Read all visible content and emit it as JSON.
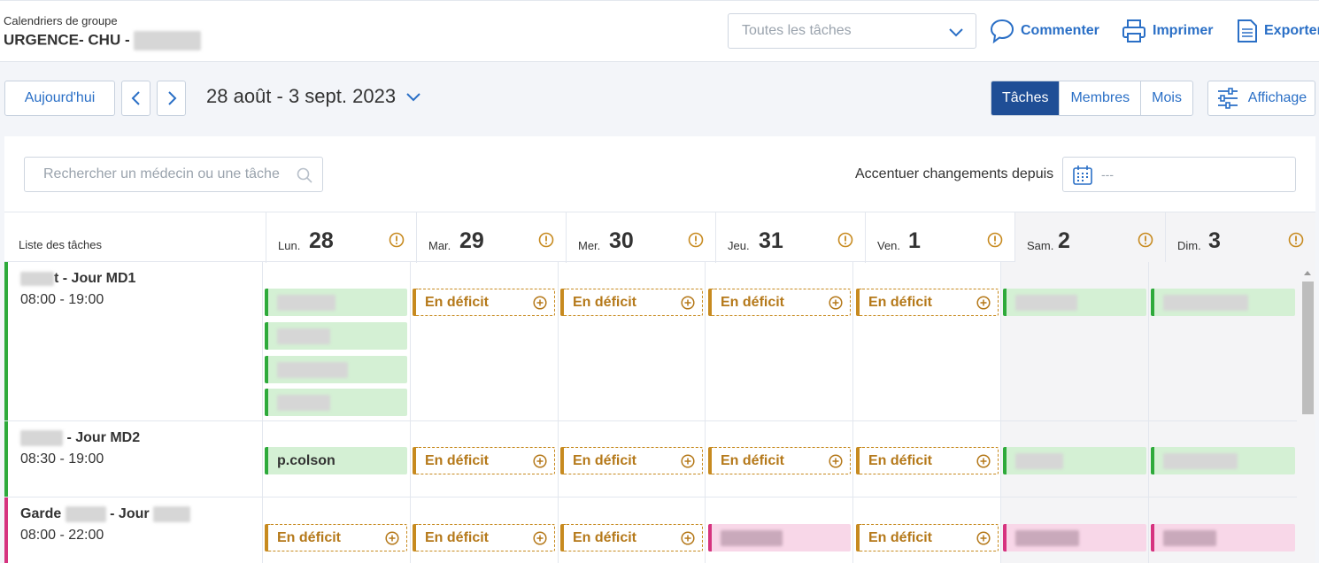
{
  "header": {
    "group_label": "Calendriers de groupe",
    "group_name": "URGENCE- CHU -",
    "task_filter": "Toutes les tâches",
    "comment": "Commenter",
    "print": "Imprimer",
    "export": "Exporter"
  },
  "toolbar": {
    "today": "Aujourd'hui",
    "date_range": "28 août - 3 sept. 2023",
    "views": [
      "Tâches",
      "Membres",
      "Mois"
    ],
    "active_view": "Tâches",
    "display": "Affichage"
  },
  "filters": {
    "search_placeholder": "Rechercher un médecin ou une tâche",
    "accent_label": "Accentuer changements depuis",
    "accent_value": "---"
  },
  "grid": {
    "list_title": "Liste des tâches",
    "days": [
      {
        "name": "Lun.",
        "num": "28"
      },
      {
        "name": "Mar.",
        "num": "29"
      },
      {
        "name": "Mer.",
        "num": "30"
      },
      {
        "name": "Jeu.",
        "num": "31"
      },
      {
        "name": "Ven.",
        "num": "1"
      },
      {
        "name": "Sam.",
        "num": "2"
      },
      {
        "name": "Dim.",
        "num": "3"
      }
    ],
    "tasks": [
      {
        "name_suffix": "t - Jour MD1",
        "time": "08:00 - 19:00",
        "color": "#2eaa3b"
      },
      {
        "name_suffix": "- Jour MD2",
        "time": "08:30 - 19:00",
        "color": "#2eaa3b"
      },
      {
        "name_prefix": "Garde",
        "name_mid": "- Jour",
        "time": "08:00 - 22:00",
        "color": "#d6337f"
      }
    ],
    "deficit_label": "En déficit",
    "member_label": "p.colson"
  }
}
